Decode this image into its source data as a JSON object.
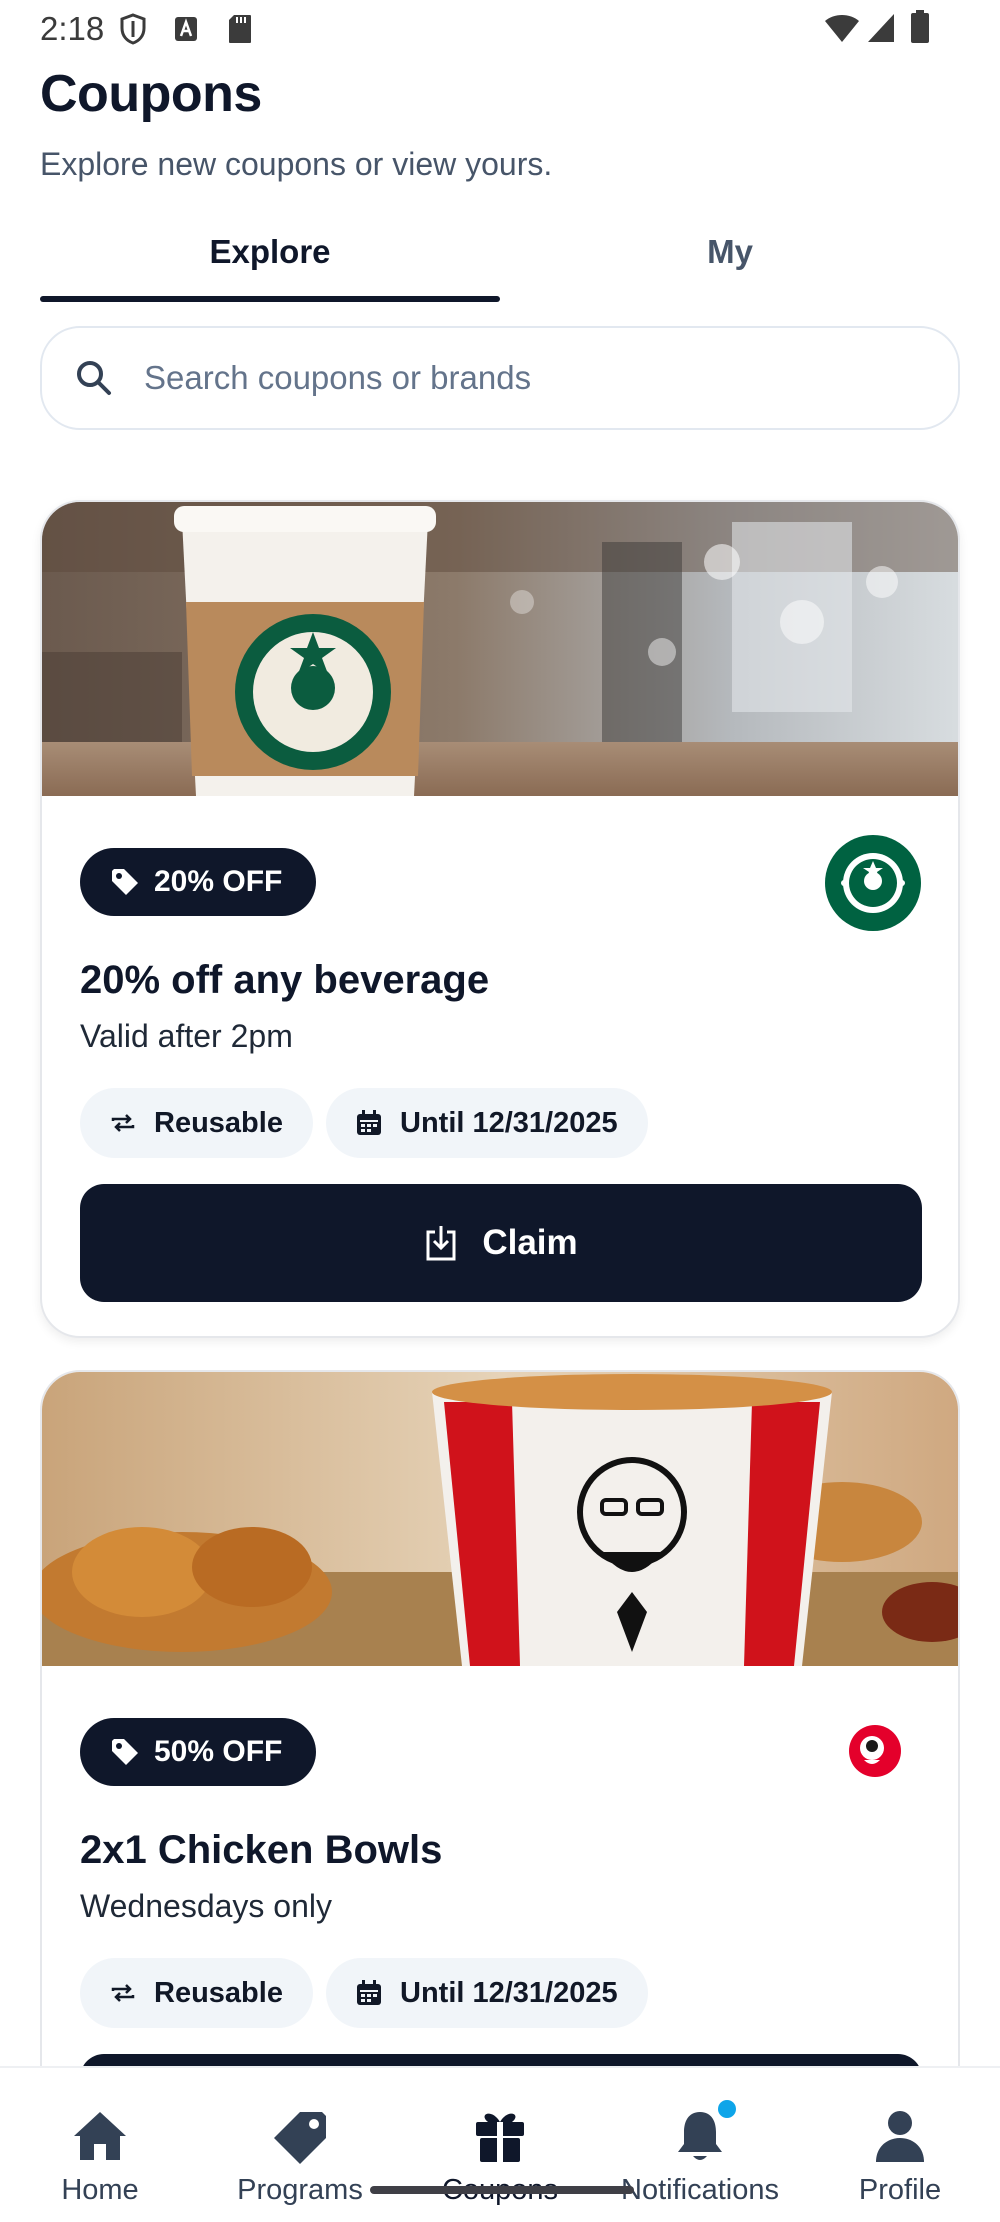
{
  "status_bar": {
    "time": "2:18"
  },
  "header": {
    "title": "Coupons",
    "subtitle": "Explore new coupons or view yours."
  },
  "tabs": [
    {
      "label": "Explore",
      "active": true
    },
    {
      "label": "My",
      "active": false
    }
  ],
  "search": {
    "placeholder": "Search coupons or brands",
    "value": ""
  },
  "coupons": [
    {
      "brand": "Starbucks",
      "badge": "20% OFF",
      "title": "20% off any beverage",
      "description": "Valid after 2pm",
      "chips": [
        "Reusable",
        "Until 12/31/2025"
      ],
      "action": "Claim"
    },
    {
      "brand": "KFC",
      "badge": "50% OFF",
      "title": "2x1 Chicken Bowls",
      "description": "Wednesdays only",
      "chips": [
        "Reusable",
        "Until 12/31/2025"
      ]
    }
  ],
  "bottom_nav": [
    {
      "label": "Home",
      "icon": "home-icon"
    },
    {
      "label": "Programs",
      "icon": "tag-icon"
    },
    {
      "label": "Coupons",
      "icon": "gift-icon",
      "active": true
    },
    {
      "label": "Notifications",
      "icon": "bell-icon",
      "has_dot": true
    },
    {
      "label": "Profile",
      "icon": "person-icon"
    }
  ],
  "colors": {
    "primary": "#0f172a",
    "chip_bg": "#f1f5f9",
    "notification_dot": "#0ea5e9",
    "starbucks_green": "#006241",
    "kfc_red": "#e4002b"
  }
}
